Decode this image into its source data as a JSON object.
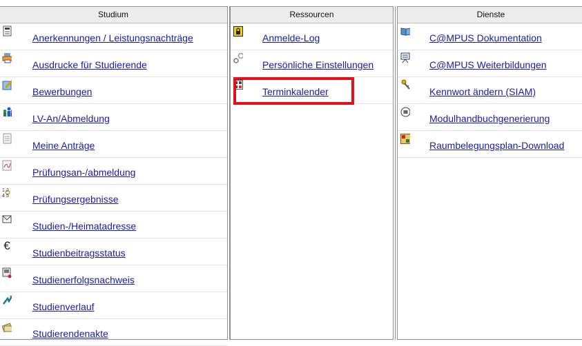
{
  "columns": [
    {
      "header": "Studium",
      "items": [
        {
          "label": "Anerkennungen / Leistungsnachträge",
          "icon": "document-stack-icon"
        },
        {
          "label": "Ausdrucke für Studierende",
          "icon": "printer-icon"
        },
        {
          "label": "Bewerbungen",
          "icon": "application-form-icon"
        },
        {
          "label": "LV-An/Abmeldung",
          "icon": "people-icon"
        },
        {
          "label": "Meine Anträge",
          "icon": "page-icon"
        },
        {
          "label": "Prüfungsan-/abmeldung",
          "icon": "signed-page-icon"
        },
        {
          "label": "Prüfungsergebnisse",
          "icon": "results-icon"
        },
        {
          "label": "Studien-/Heimatadresse",
          "icon": "envelope-icon"
        },
        {
          "label": "Studienbeitragsstatus",
          "icon": "euro-icon"
        },
        {
          "label": "Studienerfolgsnachweis",
          "icon": "certificate-icon"
        },
        {
          "label": "Studienverlauf",
          "icon": "path-arrow-icon"
        },
        {
          "label": "Studierendenakte",
          "icon": "folder-stack-icon"
        }
      ]
    },
    {
      "header": "Ressourcen",
      "items": [
        {
          "label": "Anmelde-Log",
          "icon": "lock-icon"
        },
        {
          "label": "Persönliche Einstellungen",
          "icon": "gears-icon"
        },
        {
          "label": "Terminkalender",
          "icon": "calendar-icon"
        }
      ]
    },
    {
      "header": "Dienste",
      "items": [
        {
          "label": "C@MPUS Dokumentation",
          "icon": "book-icon"
        },
        {
          "label": "C@MPUS Weiterbildungen",
          "icon": "presentation-board-icon"
        },
        {
          "label": "Kennwort ändern (SIAM)",
          "icon": "keys-icon"
        },
        {
          "label": "Modulhandbuchgenerierung",
          "icon": "module-handbook-icon"
        },
        {
          "label": "Raumbelegungsplan-Download",
          "icon": "room-plan-icon"
        }
      ]
    }
  ],
  "colors": {
    "link": "#1a1aa6",
    "highlight": "#e0101e",
    "header_bg": "#ededed"
  }
}
